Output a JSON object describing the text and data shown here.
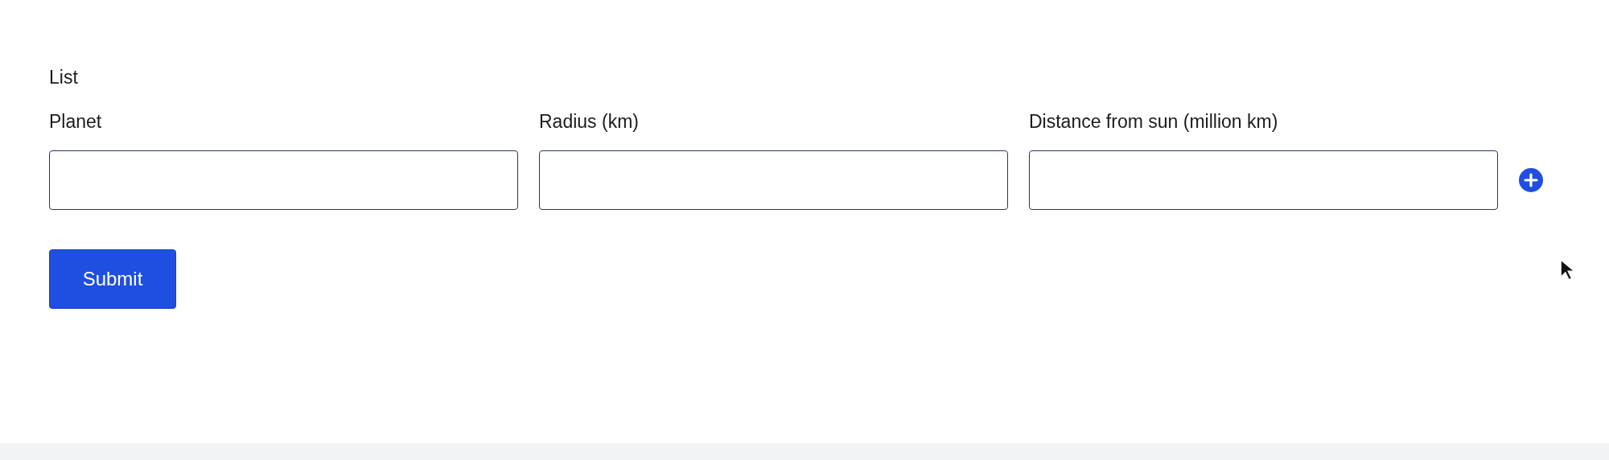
{
  "form": {
    "title": "List",
    "columns": [
      {
        "label": "Planet"
      },
      {
        "label": "Radius (km)"
      },
      {
        "label": "Distance from sun (million km)"
      }
    ],
    "submit": {
      "label": "Submit"
    }
  }
}
